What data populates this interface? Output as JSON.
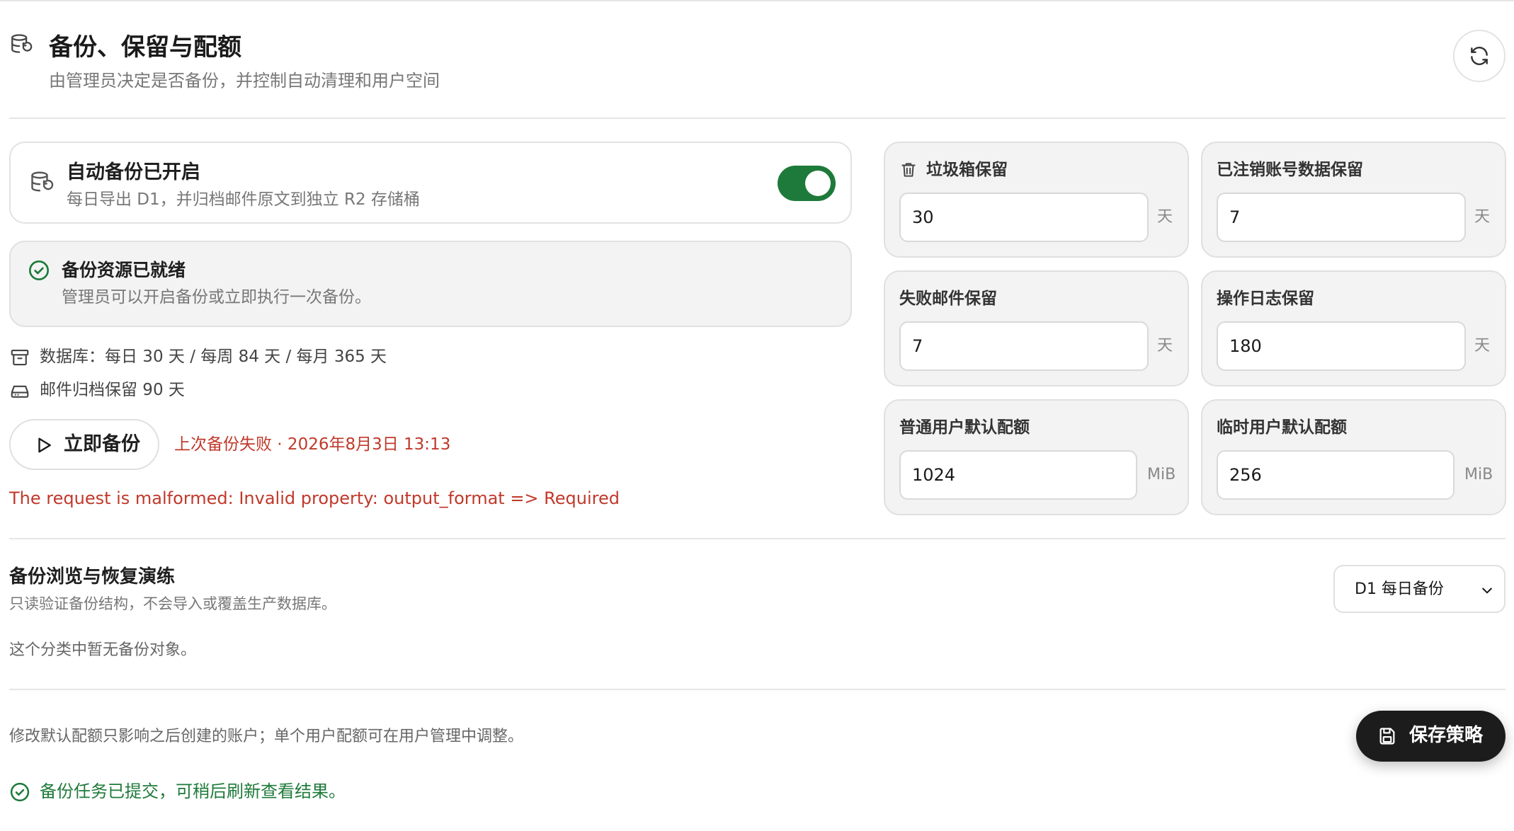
{
  "header": {
    "title": "备份、保留与配额",
    "subtitle": "由管理员决定是否备份，并控制自动清理和用户空间"
  },
  "auto_backup": {
    "title": "自动备份已开启",
    "subtitle": "每日导出 D1，并归档邮件原文到独立 R2 存储桶",
    "enabled": true
  },
  "resource_status": {
    "title": "备份资源已就绪",
    "subtitle": "管理员可以开启备份或立即执行一次备份。"
  },
  "info": {
    "database_retention": "数据库：每日 30 天 / 每周 84 天 / 每月 365 天",
    "mail_archive_retention": "邮件归档保留 90 天"
  },
  "actions": {
    "backup_now_label": "立即备份",
    "last_backup_status": "上次备份失败 · 2026年8月3日 13:13",
    "error_message": "The request is malformed: Invalid property: output_format => Required"
  },
  "retention": {
    "trash": {
      "label": "垃圾箱保留",
      "value": "30",
      "unit": "天"
    },
    "deleted_accounts": {
      "label": "已注销账号数据保留",
      "value": "7",
      "unit": "天"
    },
    "failed_mail": {
      "label": "失败邮件保留",
      "value": "7",
      "unit": "天"
    },
    "operation_log": {
      "label": "操作日志保留",
      "value": "180",
      "unit": "天"
    },
    "regular_quota": {
      "label": "普通用户默认配额",
      "value": "1024",
      "unit": "MiB"
    },
    "temp_quota": {
      "label": "临时用户默认配额",
      "value": "256",
      "unit": "MiB"
    }
  },
  "browse": {
    "title": "备份浏览与恢复演练",
    "subtitle": "只读验证备份结构，不会导入或覆盖生产数据库。",
    "selected_option": "D1 每日备份",
    "empty_message": "这个分类中暂无备份对象。"
  },
  "footer": {
    "note": "修改默认配额只影响之后创建的账户；单个用户配额可在用户管理中调整。",
    "save_label": "保存策略",
    "success_message": "备份任务已提交，可稍后刷新查看结果。"
  },
  "colors": {
    "accent_green": "#1e7a3a",
    "error_red": "#c0392b",
    "dark_button": "#1c1c1c"
  },
  "icons": [
    "database-restore-icon",
    "refresh-icon",
    "check-circle-icon",
    "archive-icon",
    "hard-drive-icon",
    "play-icon",
    "trash-icon",
    "chevron-down-icon",
    "save-icon"
  ]
}
